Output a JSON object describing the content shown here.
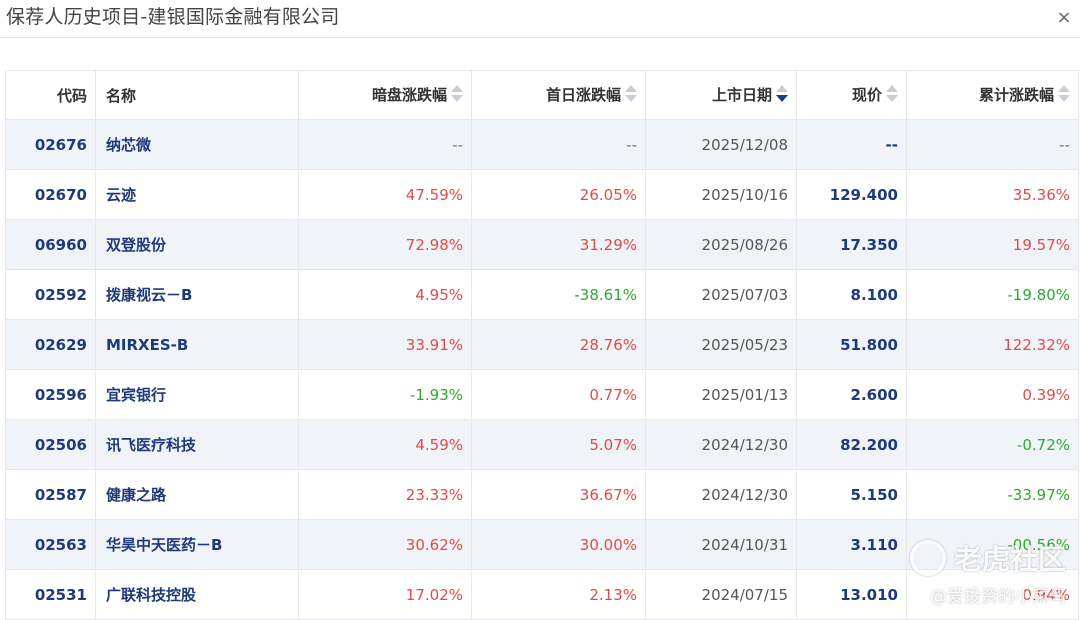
{
  "dialog": {
    "title": "保荐人历史项目-建银国际金融有限公司",
    "close_label": "×"
  },
  "colors": {
    "positive": "#e04b4b",
    "negative": "#2faa2f",
    "neutral": "#777777",
    "code_text": "#1e3a78"
  },
  "table": {
    "headers": {
      "code": "代码",
      "name": "名称",
      "grey_market_change": "暗盘涨跌幅",
      "first_day_change": "首日涨跌幅",
      "listing_date": "上市日期",
      "price": "现价",
      "cumulative_change": "累计涨跌幅"
    },
    "sort": {
      "column": "listing_date",
      "direction": "desc"
    },
    "rows": [
      {
        "code": "02676",
        "name": "纳芯微",
        "grey": "--",
        "first": "--",
        "date": "2025/12/08",
        "price": "--",
        "cum": "--"
      },
      {
        "code": "02670",
        "name": "云迹",
        "grey": "47.59%",
        "first": "26.05%",
        "date": "2025/10/16",
        "price": "129.400",
        "cum": "35.36%"
      },
      {
        "code": "06960",
        "name": "双登股份",
        "grey": "72.98%",
        "first": "31.29%",
        "date": "2025/08/26",
        "price": "17.350",
        "cum": "19.57%"
      },
      {
        "code": "02592",
        "name": "拨康视云－B",
        "grey": "4.95%",
        "first": "-38.61%",
        "date": "2025/07/03",
        "price": "8.100",
        "cum": "-19.80%"
      },
      {
        "code": "02629",
        "name": "MIRXES-B",
        "grey": "33.91%",
        "first": "28.76%",
        "date": "2025/05/23",
        "price": "51.800",
        "cum": "122.32%"
      },
      {
        "code": "02596",
        "name": "宜宾银行",
        "grey": "-1.93%",
        "first": "0.77%",
        "date": "2025/01/13",
        "price": "2.600",
        "cum": "0.39%"
      },
      {
        "code": "02506",
        "name": "讯飞医疗科技",
        "grey": "4.59%",
        "first": "5.07%",
        "date": "2024/12/30",
        "price": "82.200",
        "cum": "-0.72%"
      },
      {
        "code": "02587",
        "name": "健康之路",
        "grey": "23.33%",
        "first": "36.67%",
        "date": "2024/12/30",
        "price": "5.150",
        "cum": "-33.97%"
      },
      {
        "code": "02563",
        "name": "华昊中天医药－B",
        "grey": "30.62%",
        "first": "30.00%",
        "date": "2024/10/31",
        "price": "3.110",
        "cum": "-00.56%"
      },
      {
        "code": "02531",
        "name": "广联科技控股",
        "grey": "17.02%",
        "first": "2.13%",
        "date": "2024/07/15",
        "price": "13.010",
        "cum": "0.94%"
      }
    ]
  },
  "watermark": {
    "brand": "老虎社区",
    "user": "@爱投资的小菜鸟"
  }
}
